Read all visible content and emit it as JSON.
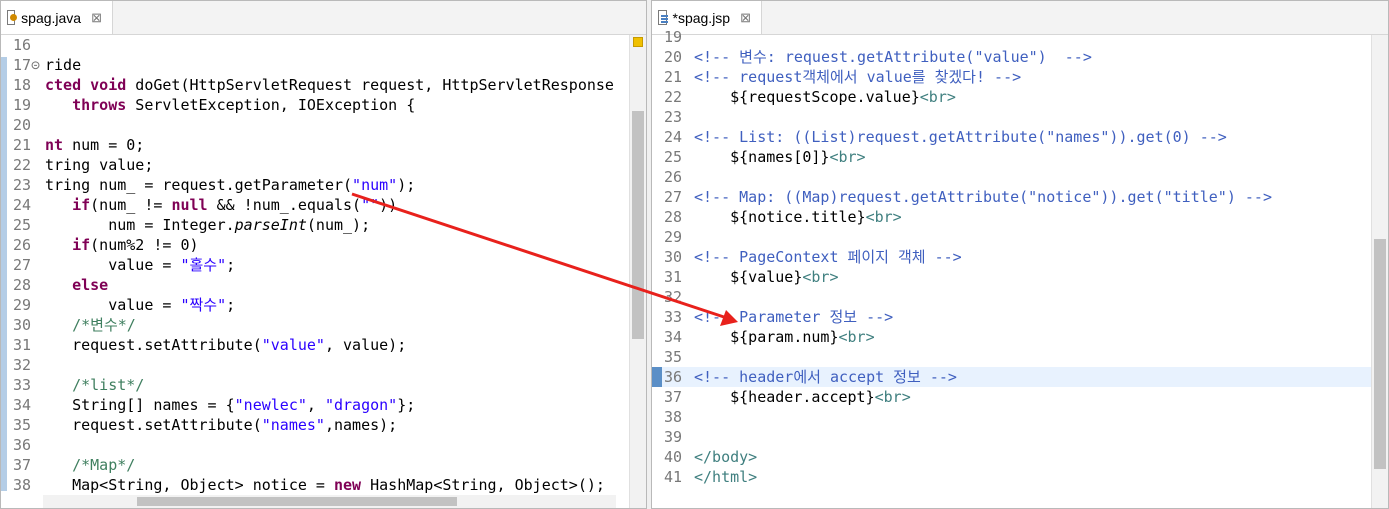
{
  "left_editor": {
    "tab_label": "spag.java",
    "close_glyph": "⊠",
    "lines": [
      {
        "n": "16",
        "html": ""
      },
      {
        "n": "17⊝",
        "html": "ride"
      },
      {
        "n": "18",
        "html": "<span class=\"kw\">cted void</span> doGet(HttpServletRequest request, HttpServletResponse"
      },
      {
        "n": "19",
        "html": "   <span class=\"kw\">throws</span> ServletException, IOException {"
      },
      {
        "n": "20",
        "html": ""
      },
      {
        "n": "21",
        "html": "<span class=\"kw\">nt</span> num = 0;"
      },
      {
        "n": "22",
        "html": "tring value;"
      },
      {
        "n": "23",
        "html": "tring num_ = request.getParameter(<span class=\"str\">\"num\"</span>);"
      },
      {
        "n": "24",
        "html": "   <span class=\"kw\">if</span>(num_ != <span class=\"kw\">null</span> &amp;&amp; !num_.equals(<span class=\"str\">\"\"</span>))"
      },
      {
        "n": "25",
        "html": "       num = Integer.<span class=\"it\">parseInt</span>(num_);"
      },
      {
        "n": "26",
        "html": "   <span class=\"kw\">if</span>(num%2 != 0)"
      },
      {
        "n": "27",
        "html": "       value = <span class=\"str\">\"홀수\"</span>;"
      },
      {
        "n": "28",
        "html": "   <span class=\"kw\">else</span>"
      },
      {
        "n": "29",
        "html": "       value = <span class=\"str\">\"짝수\"</span>;"
      },
      {
        "n": "30",
        "html": "   <span class=\"cm\">/*변수*/</span>"
      },
      {
        "n": "31",
        "html": "   request.setAttribute(<span class=\"str\">\"value\"</span>, value);"
      },
      {
        "n": "32",
        "html": ""
      },
      {
        "n": "33",
        "html": "   <span class=\"cm\">/*list*/</span>"
      },
      {
        "n": "34",
        "html": "   String[] names = {<span class=\"str\">\"newlec\"</span>, <span class=\"str\">\"dragon\"</span>};"
      },
      {
        "n": "35",
        "html": "   request.setAttribute(<span class=\"str\">\"names\"</span>,names);"
      },
      {
        "n": "36",
        "html": ""
      },
      {
        "n": "37",
        "html": "   <span class=\"cm\">/*Map*/</span>"
      },
      {
        "n": "38",
        "html": "   Map&lt;String, Object&gt; notice = <span class=\"kw\">new</span> HashMap&lt;String, Object&gt;();"
      }
    ]
  },
  "right_editor": {
    "tab_label": "*spag.jsp",
    "close_glyph": "⊠",
    "lines": [
      {
        "n": "19",
        "html": ""
      },
      {
        "n": "20",
        "html": "<span class=\"jcm\">&lt;!-- 변수: request.getAttribute(\"value\")  --&gt;</span>"
      },
      {
        "n": "21",
        "html": "<span class=\"jcm\">&lt;!-- request객체에서 value를 찾겠다! --&gt;</span>"
      },
      {
        "n": "22",
        "html": "    ${requestScope.value}<span class=\"tag\">&lt;br&gt;</span>"
      },
      {
        "n": "23",
        "html": ""
      },
      {
        "n": "24",
        "html": "<span class=\"jcm\">&lt;!-- List: ((List)request.getAttribute(\"names\")).get(0) --&gt;</span>"
      },
      {
        "n": "25",
        "html": "    ${names[0]}<span class=\"tag\">&lt;br&gt;</span>"
      },
      {
        "n": "26",
        "html": ""
      },
      {
        "n": "27",
        "html": "<span class=\"jcm\">&lt;!-- Map: ((Map)request.getAttribute(\"notice\")).get(\"title\") --&gt;</span>"
      },
      {
        "n": "28",
        "html": "    ${notice.title}<span class=\"tag\">&lt;br&gt;</span>"
      },
      {
        "n": "29",
        "html": ""
      },
      {
        "n": "30",
        "html": "<span class=\"jcm\">&lt;!-- PageContext 페이지 객체 --&gt;</span>"
      },
      {
        "n": "31",
        "html": "    ${value}<span class=\"tag\">&lt;br&gt;</span>"
      },
      {
        "n": "32",
        "html": ""
      },
      {
        "n": "33",
        "html": "<span class=\"jcm\">&lt;!-- Parameter 정보 --&gt;</span>"
      },
      {
        "n": "34",
        "html": "    ${param.num}<span class=\"tag\">&lt;br&gt;</span>"
      },
      {
        "n": "35",
        "html": ""
      },
      {
        "n": "36",
        "html": "<span class=\"jcm\">&lt;!-- header에서 accept 정보 --&gt;</span>"
      },
      {
        "n": "37",
        "html": "    ${header.accept}<span class=\"tag\">&lt;br&gt;</span>"
      },
      {
        "n": "38",
        "html": ""
      },
      {
        "n": "39",
        "html": ""
      },
      {
        "n": "40",
        "html": "<span class=\"tag\">&lt;/body&gt;</span>"
      },
      {
        "n": "41",
        "html": "<span class=\"tag\">&lt;/html&gt;</span>"
      }
    ]
  },
  "annotation": {
    "type": "arrow",
    "color": "#e8211c"
  }
}
